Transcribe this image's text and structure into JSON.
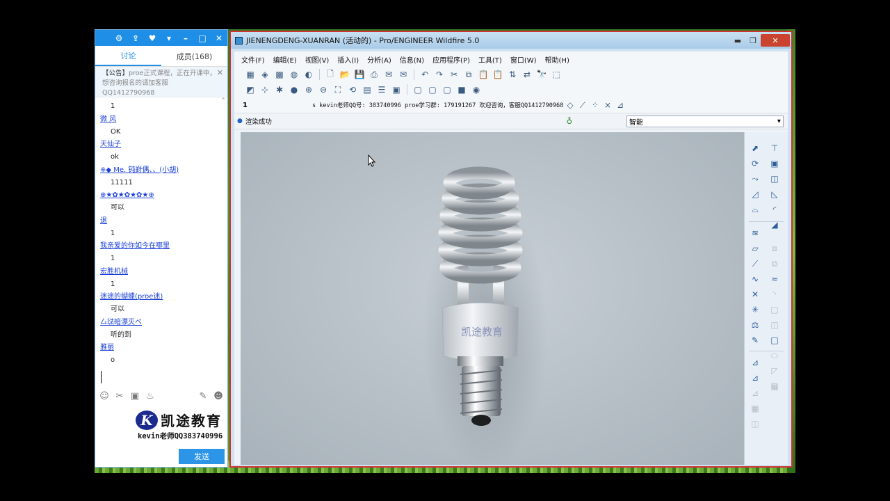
{
  "qq": {
    "tabs": [
      {
        "label": "讨论",
        "active": true
      },
      {
        "label": "成员(168)",
        "active": false
      }
    ],
    "notice": {
      "tag": "【公告】",
      "text": "proe正式课程，正在开课中，想咨询报名的请加客服QQ1412790968"
    },
    "messages": [
      {
        "type": "text",
        "text": "1"
      },
      {
        "type": "name",
        "text": "微 风"
      },
      {
        "type": "text",
        "text": "OK"
      },
      {
        "type": "name",
        "text": "天仙子"
      },
      {
        "type": "text",
        "text": "ok"
      },
      {
        "type": "name",
        "text": "※◆ Me. 钝崶偶、、(小胡)"
      },
      {
        "type": "text",
        "text": "11111"
      },
      {
        "type": "name",
        "text": " ⊕★✿★✿★✿★⊕"
      },
      {
        "type": "text",
        "text": "可以"
      },
      {
        "type": "name",
        "text": "退"
      },
      {
        "type": "text",
        "text": "1"
      },
      {
        "type": "name",
        "text": "我亲爱的你如今在哪里"
      },
      {
        "type": "text",
        "text": "1"
      },
      {
        "type": "name",
        "text": "宏胜机械"
      },
      {
        "type": "text",
        "text": "1"
      },
      {
        "type": "name",
        "text": "迷途的蝴蝶(proe迷)"
      },
      {
        "type": "text",
        "text": "可以"
      },
      {
        "type": "name",
        "text": "厶琺暗漂灭ベ"
      },
      {
        "type": "text",
        "text": "听的到"
      },
      {
        "type": "name",
        "text": "雅丽"
      },
      {
        "type": "text",
        "text": "o"
      }
    ],
    "logo_text": "凯途教育",
    "logo_mark": "K",
    "kevin_line": "kevin老师QQ383740996",
    "send_label": "发送"
  },
  "proe": {
    "title": "JIENENGDENG-XUANRAN (活动的) - Pro/ENGINEER Wildfire 5.0",
    "menus": [
      "文件(F)",
      "编辑(E)",
      "视图(V)",
      "插入(I)",
      "分析(A)",
      "信息(N)",
      "应用程序(P)",
      "工具(T)",
      "窗口(W)",
      "帮助(H)"
    ],
    "toolbar3_number": "1",
    "toolbar3_info": "s kevin老师QQ号: 383740996 proe学习群: 179191267 欢迎咨询，客服QQ1412790968",
    "status_message": "渲染成功",
    "filter_value": "智能",
    "bulb_label": "凯途教育"
  },
  "colors": {
    "qq_accent": "#1e8ee6",
    "proe_frame": "#cfe2f1",
    "viewport_bg": "#b6bfc6",
    "link_blue": "#1a3fd8"
  }
}
